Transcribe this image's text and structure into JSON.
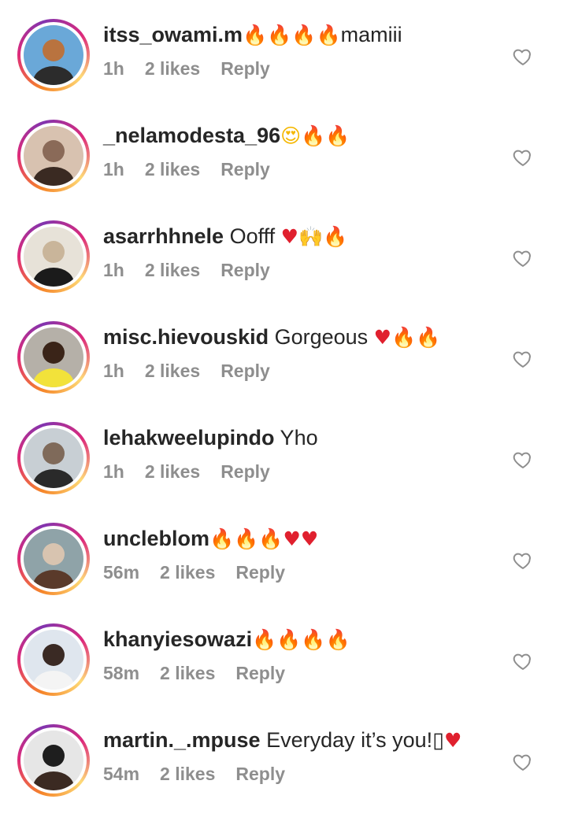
{
  "comments": [
    {
      "username": "itss_owami.m",
      "text_parts": [
        {
          "t": "🔥",
          "k": "fire"
        },
        {
          "t": "🔥",
          "k": "fire"
        },
        {
          "t": "🔥",
          "k": "fire"
        },
        {
          "t": "🔥",
          "k": "fire"
        },
        {
          "t": "mamiii",
          "k": "text"
        }
      ],
      "time": "1h",
      "likes": "2 likes",
      "reply": "Reply",
      "avatar_colors": [
        "#6aa8d8",
        "#2c2c2c",
        "#b9733f"
      ]
    },
    {
      "username": "_nelamodesta_96",
      "text_parts": [
        {
          "t": "😍",
          "k": "smile"
        },
        {
          "t": "🔥",
          "k": "fire"
        },
        {
          "t": "🔥",
          "k": "fire"
        }
      ],
      "time": "1h",
      "likes": "2 likes",
      "reply": "Reply",
      "avatar_colors": [
        "#d8c2b0",
        "#3a2a22",
        "#8a6a58"
      ]
    },
    {
      "username": "asarrhhnele",
      "text_parts": [
        {
          "t": " Oofff ",
          "k": "text"
        },
        {
          "t": "♥",
          "k": "redheart"
        },
        {
          "t": "🙌",
          "k": "hands"
        },
        {
          "t": "🔥",
          "k": "fire"
        }
      ],
      "time": "1h",
      "likes": "2 likes",
      "reply": "Reply",
      "avatar_colors": [
        "#e7e2d8",
        "#1b1b1b",
        "#c9b59a"
      ]
    },
    {
      "username": "misc.hievouskid",
      "text_parts": [
        {
          "t": " Gorgeous ",
          "k": "text"
        },
        {
          "t": "♥",
          "k": "redheart"
        },
        {
          "t": "🔥",
          "k": "fire"
        },
        {
          "t": "🔥",
          "k": "fire"
        }
      ],
      "time": "1h",
      "likes": "2 likes",
      "reply": "Reply",
      "avatar_colors": [
        "#b5b0a8",
        "#f2e23a",
        "#3a2418"
      ]
    },
    {
      "username": "lehakweelupindo",
      "text_parts": [
        {
          "t": " Yho",
          "k": "text"
        }
      ],
      "time": "1h",
      "likes": "2 likes",
      "reply": "Reply",
      "avatar_colors": [
        "#c8cfd4",
        "#2a2a2a",
        "#7f6a5a"
      ]
    },
    {
      "username": "uncleblom",
      "text_parts": [
        {
          "t": "🔥",
          "k": "fire"
        },
        {
          "t": "🔥",
          "k": "fire"
        },
        {
          "t": "🔥",
          "k": "fire"
        },
        {
          "t": "♥",
          "k": "redheart"
        },
        {
          "t": "♥",
          "k": "redheart"
        }
      ],
      "time": "56m",
      "likes": "2 likes",
      "reply": "Reply",
      "avatar_colors": [
        "#8fa3a8",
        "#5a3a2a",
        "#d8c4b0"
      ]
    },
    {
      "username": "khanyiesowazi",
      "text_parts": [
        {
          "t": "🔥",
          "k": "fire"
        },
        {
          "t": "🔥",
          "k": "fire"
        },
        {
          "t": "🔥",
          "k": "fire"
        },
        {
          "t": "🔥",
          "k": "fire"
        }
      ],
      "time": "58m",
      "likes": "2 likes",
      "reply": "Reply",
      "avatar_colors": [
        "#dfe6ee",
        "#f4f4f4",
        "#3a2a24"
      ]
    },
    {
      "username": "martin._.mpuse",
      "text_parts": [
        {
          "t": " Everyday it’s you!",
          "k": "text"
        },
        {
          "t": "▯",
          "k": "text"
        },
        {
          "t": "♥",
          "k": "redheart"
        }
      ],
      "time": "54m",
      "likes": "2 likes",
      "reply": "Reply",
      "avatar_colors": [
        "#e6e6e6",
        "#3b2a22",
        "#1e1e1e"
      ]
    }
  ]
}
